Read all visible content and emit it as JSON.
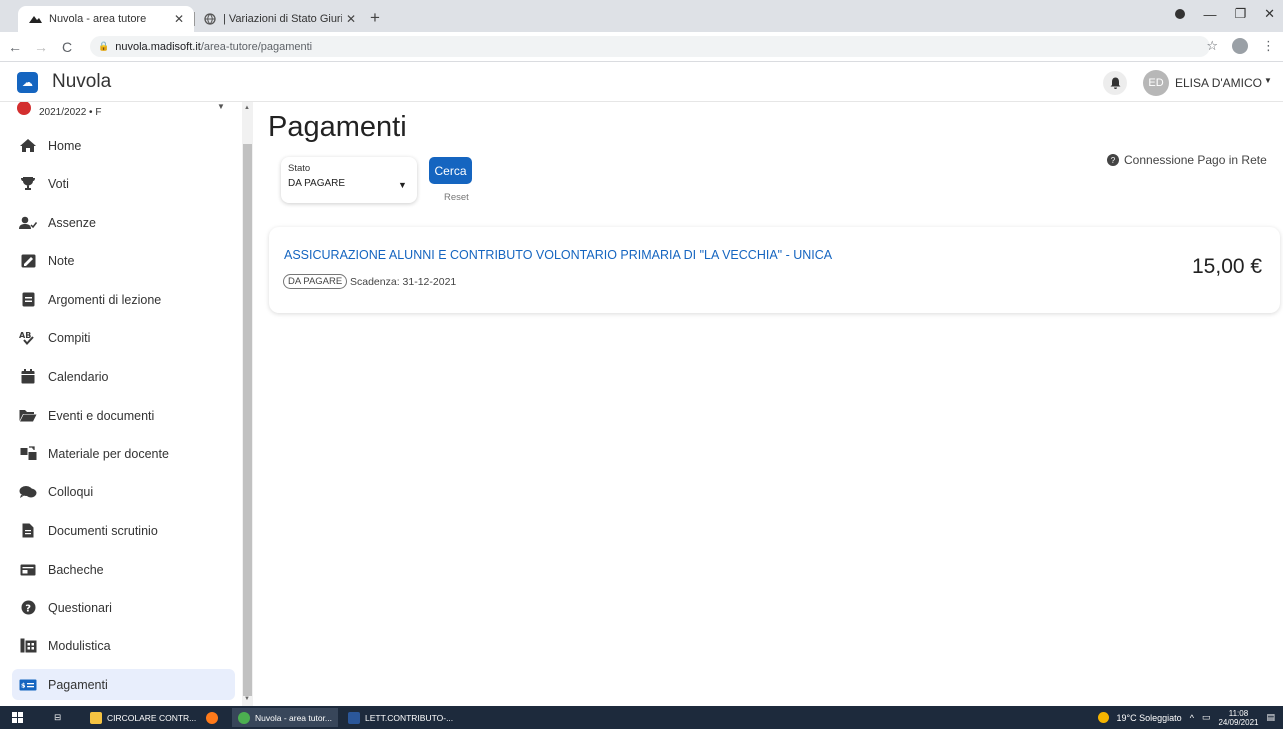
{
  "browser": {
    "tabs": [
      {
        "title": "Nuvola - area tutore",
        "active": true
      },
      {
        "title": "| Variazioni di Stato Giuridico",
        "active": false
      }
    ],
    "url_host": "nuvola.madisoft.it",
    "url_path": "/area-tutore/pagamenti"
  },
  "header": {
    "app_name": "Nuvola",
    "user_initials": "ED",
    "user_name": "ELISA D'AMICO"
  },
  "sidebar": {
    "year": "2021/2022 • F",
    "items": [
      {
        "label": "Home",
        "icon": "home-icon"
      },
      {
        "label": "Voti",
        "icon": "trophy-icon"
      },
      {
        "label": "Assenze",
        "icon": "user-check-icon"
      },
      {
        "label": "Note",
        "icon": "note-icon"
      },
      {
        "label": "Argomenti di lezione",
        "icon": "list-icon"
      },
      {
        "label": "Compiti",
        "icon": "spellcheck-icon"
      },
      {
        "label": "Calendario",
        "icon": "calendar-icon"
      },
      {
        "label": "Eventi e documenti",
        "icon": "folder-icon"
      },
      {
        "label": "Materiale per docente",
        "icon": "transfer-icon"
      },
      {
        "label": "Colloqui",
        "icon": "chat-icon"
      },
      {
        "label": "Documenti scrutinio",
        "icon": "file-icon"
      },
      {
        "label": "Bacheche",
        "icon": "board-icon"
      },
      {
        "label": "Questionari",
        "icon": "question-icon"
      },
      {
        "label": "Modulistica",
        "icon": "forms-icon"
      },
      {
        "label": "Pagamenti",
        "icon": "payment-icon",
        "selected": true
      }
    ]
  },
  "main": {
    "title": "Pagamenti",
    "filter": {
      "label": "Stato",
      "value": "DA PAGARE"
    },
    "search_label": "Cerca",
    "reset_label": "Reset",
    "connessione_label": "Connessione Pago in Rete",
    "payments": [
      {
        "title": "ASSICURAZIONE ALUNNI E CONTRIBUTO VOLONTARIO PRIMARIA DI \"LA VECCHIA\" - UNICA",
        "status": "DA PAGARE",
        "due": "Scadenza: 31-12-2021",
        "amount": "15,00 €"
      }
    ]
  },
  "taskbar": {
    "items": [
      {
        "label": "CIRCOLARE CONTR..."
      },
      {
        "label": "Nuvola - area tutor..."
      },
      {
        "label": "LETT.CONTRIBUTO-..."
      }
    ],
    "weather": "19°C Soleggiato",
    "time": "11:08",
    "date": "24/09/2021"
  },
  "colors": {
    "accent": "#1565c0",
    "sidebar_selected": "#e8eefc",
    "taskbar": "#1d2a3c"
  }
}
